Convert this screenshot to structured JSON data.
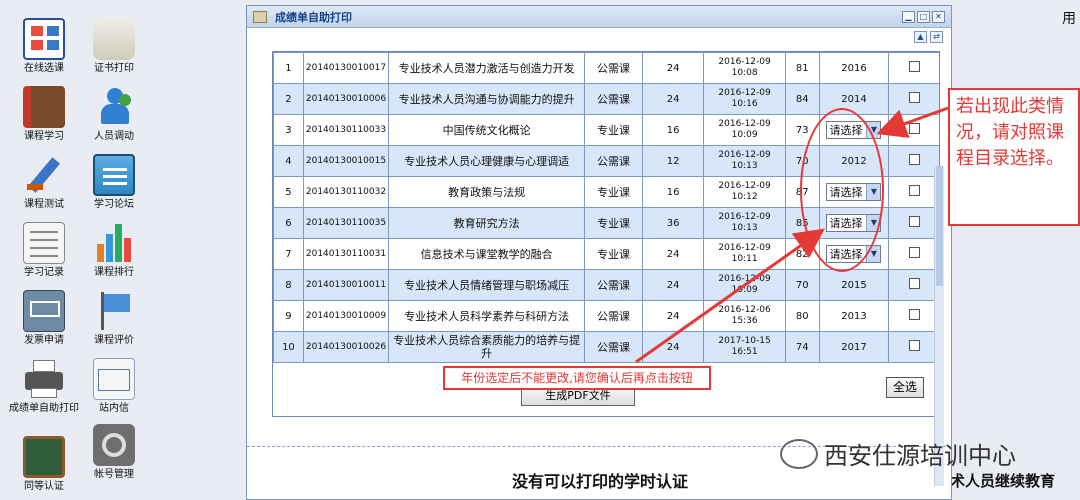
{
  "desktop": {
    "items": [
      {
        "label": "在线选课",
        "icon": "course-selection-icon"
      },
      {
        "label": "证书打印",
        "icon": "certificate-scroll-icon"
      },
      {
        "label": "课程学习",
        "icon": "book-icon"
      },
      {
        "label": "人员调动",
        "icon": "people-icon"
      },
      {
        "label": "课程测试",
        "icon": "pencil-icon"
      },
      {
        "label": "学习论坛",
        "icon": "forum-icon"
      },
      {
        "label": "学习记录",
        "icon": "notebook-icon"
      },
      {
        "label": "课程排行",
        "icon": "bar-chart-icon"
      },
      {
        "label": "发票申请",
        "icon": "invoice-icon"
      },
      {
        "label": "课程评价",
        "icon": "flag-icon"
      },
      {
        "label": "成绩单自助打印",
        "icon": "printer-icon"
      },
      {
        "label": "站内信",
        "icon": "mail-icon"
      },
      {
        "label": "同等认证",
        "icon": "blackboard-icon"
      },
      {
        "label": "帐号管理",
        "icon": "gear-icon"
      }
    ],
    "right_top_text": "用",
    "bottom_right_text": "术人员继续教育",
    "watermark": "西安仕源培训中心"
  },
  "dialog": {
    "title": "成绩单自助打印",
    "rows": [
      {
        "no": "1",
        "code": "20140130010017",
        "name": "专业技术人员潜力激活与创造力开发",
        "type": "公需课",
        "hours": "24",
        "time": "2016-12-09 10:08",
        "score": "81",
        "year": "2016",
        "select": false
      },
      {
        "no": "2",
        "code": "20140130010006",
        "name": "专业技术人员沟通与协调能力的提升",
        "type": "公需课",
        "hours": "24",
        "time": "2016-12-09 10:16",
        "score": "84",
        "year": "2014",
        "select": false
      },
      {
        "no": "3",
        "code": "20140130110033",
        "name": "中国传统文化概论",
        "type": "专业课",
        "hours": "16",
        "time": "2016-12-09 10:09",
        "score": "73",
        "year": "请选择",
        "select": true
      },
      {
        "no": "4",
        "code": "20140130010015",
        "name": "专业技术人员心理健康与心理调适",
        "type": "公需课",
        "hours": "12",
        "time": "2016-12-09 10:13",
        "score": "70",
        "year": "2012",
        "select": false
      },
      {
        "no": "5",
        "code": "20140130110032",
        "name": "教育政策与法规",
        "type": "专业课",
        "hours": "16",
        "time": "2016-12-09 10:12",
        "score": "87",
        "year": "请选择",
        "select": true
      },
      {
        "no": "6",
        "code": "20140130110035",
        "name": "教育研究方法",
        "type": "专业课",
        "hours": "36",
        "time": "2016-12-09 10:13",
        "score": "85",
        "year": "请选择",
        "select": true
      },
      {
        "no": "7",
        "code": "20140130110031",
        "name": "信息技术与课堂教学的融合",
        "type": "专业课",
        "hours": "24",
        "time": "2016-12-09 10:11",
        "score": "82",
        "year": "请选择",
        "select": true
      },
      {
        "no": "8",
        "code": "20140130010011",
        "name": "专业技术人员情绪管理与职场减压",
        "type": "公需课",
        "hours": "24",
        "time": "2016-12-09 10:09",
        "score": "70",
        "year": "2015",
        "select": false
      },
      {
        "no": "9",
        "code": "20140130010009",
        "name": "专业技术人员科学素养与科研方法",
        "type": "公需课",
        "hours": "24",
        "time": "2016-12-06 15:36",
        "score": "80",
        "year": "2013",
        "select": false
      },
      {
        "no": "10",
        "code": "20140130010026",
        "name": "专业技术人员综合素质能力的培养与提升",
        "type": "公需课",
        "hours": "24",
        "time": "2017-10-15 16:51",
        "score": "74",
        "year": "2017",
        "select": false
      }
    ],
    "select_all_label": "全选",
    "generate_pdf_label": "生成PDF文件",
    "warning_text": "年份选定后不能更改,请您确认后再点击按钮",
    "no_print_text": "没有可以打印的学时认证"
  },
  "annotation": {
    "text": "若出现此类情况，请对照课程目录选择。"
  },
  "colors": {
    "annotation_red": "#e53935",
    "row_even": "#d7e6f8",
    "title_blue": "#15428b"
  }
}
